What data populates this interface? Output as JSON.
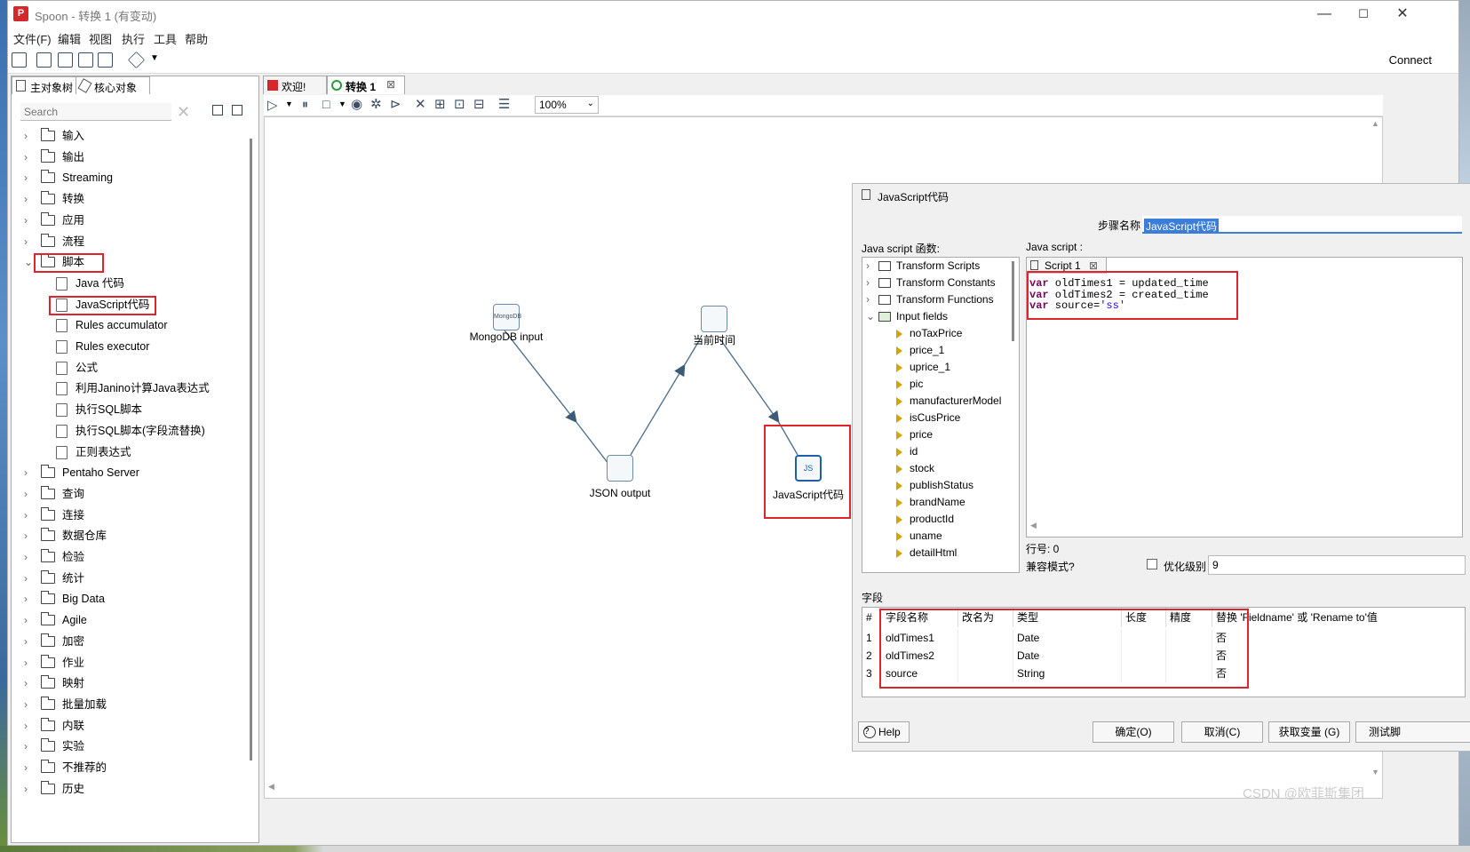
{
  "window": {
    "title": "Spoon - 转换 1 (有变动)",
    "app_icon_label": "P",
    "controls": {
      "minimize": "—",
      "maximize": "☐",
      "close": "✕"
    }
  },
  "menu": [
    "文件(F)",
    "编辑",
    "视图",
    "执行",
    "工具",
    "帮助"
  ],
  "toolbar": {
    "connect_label": "Connect"
  },
  "left_panel": {
    "tabs": [
      "主对象树",
      "核心对象"
    ],
    "search_placeholder": "Search",
    "tree": [
      {
        "label": "输入",
        "expanded": false
      },
      {
        "label": "输出",
        "expanded": false
      },
      {
        "label": "Streaming",
        "expanded": false
      },
      {
        "label": "转换",
        "expanded": false
      },
      {
        "label": "应用",
        "expanded": false
      },
      {
        "label": "流程",
        "expanded": false
      },
      {
        "label": "脚本",
        "expanded": true,
        "children": [
          "Java 代码",
          "JavaScript代码",
          "Rules accumulator",
          "Rules executor",
          "公式",
          "利用Janino计算Java表达式",
          "执行SQL脚本",
          "执行SQL脚本(字段流替换)",
          "正则表达式"
        ]
      },
      {
        "label": "Pentaho Server",
        "expanded": false
      },
      {
        "label": "查询",
        "expanded": false
      },
      {
        "label": "连接",
        "expanded": false
      },
      {
        "label": "数据仓库",
        "expanded": false
      },
      {
        "label": "检验",
        "expanded": false
      },
      {
        "label": "统计",
        "expanded": false
      },
      {
        "label": "Big Data",
        "expanded": false
      },
      {
        "label": "Agile",
        "expanded": false
      },
      {
        "label": "加密",
        "expanded": false
      },
      {
        "label": "作业",
        "expanded": false
      },
      {
        "label": "映射",
        "expanded": false
      },
      {
        "label": "批量加载",
        "expanded": false
      },
      {
        "label": "内联",
        "expanded": false
      },
      {
        "label": "实验",
        "expanded": false
      },
      {
        "label": "不推荐的",
        "expanded": false
      },
      {
        "label": "历史",
        "expanded": false
      }
    ]
  },
  "editor_tabs": [
    {
      "label": "欢迎!"
    },
    {
      "label": "转换 1",
      "active": true
    }
  ],
  "canvas": {
    "zoom": "100%",
    "steps": [
      {
        "label": "MongoDB input",
        "icon_text": "MongoDB"
      },
      {
        "label": "JSON output"
      },
      {
        "label": "当前时间"
      },
      {
        "label": "JavaScript代码",
        "icon_text": "JS"
      }
    ]
  },
  "dialog": {
    "title": "JavaScript代码",
    "step_name_label": "步骤名称",
    "step_name_value": "JavaScript代码",
    "functions_label": "Java script 函数:",
    "script_label": "Java script :",
    "function_tree": {
      "folders": [
        "Transform Scripts",
        "Transform Constants",
        "Transform Functions",
        "Input fields"
      ],
      "input_fields": [
        "noTaxPrice",
        "price_1",
        "uprice_1",
        "pic",
        "manufacturerModel",
        "isCusPrice",
        "price",
        "id",
        "stock",
        "publishStatus",
        "brandName",
        "productId",
        "uname",
        "detailHtml"
      ]
    },
    "script_tab": "Script 1",
    "script_lines": [
      {
        "kw": "var",
        "rest": " oldTimes1 = updated_time",
        "str": ""
      },
      {
        "kw": "var",
        "rest": " oldTimes2 = created_time",
        "str": ""
      },
      {
        "kw": "var",
        "rest": " source=",
        "str": "'ss'"
      }
    ],
    "line_number_label": "行号: 0",
    "compat_label": "兼容模式?",
    "optimize_label": "优化级别",
    "optimize_value": "9",
    "fields_label": "字段",
    "table": {
      "headers": [
        "#",
        "字段名称",
        "改名为",
        "类型",
        "长度",
        "精度",
        "替换 'Fieldname' 或 'Rename to'值"
      ],
      "rows": [
        [
          "1",
          "oldTimes1",
          "",
          "Date",
          "",
          "",
          "否"
        ],
        [
          "2",
          "oldTimes2",
          "",
          "Date",
          "",
          "",
          "否"
        ],
        [
          "3",
          "source",
          "",
          "String",
          "",
          "",
          "否"
        ]
      ]
    },
    "buttons": {
      "help": "Help",
      "ok": "确定(O)",
      "cancel": "取消(C)",
      "get_vars": "获取变量 (G)",
      "test": "测试脚"
    }
  },
  "watermark": "CSDN @欧菲斯集团"
}
